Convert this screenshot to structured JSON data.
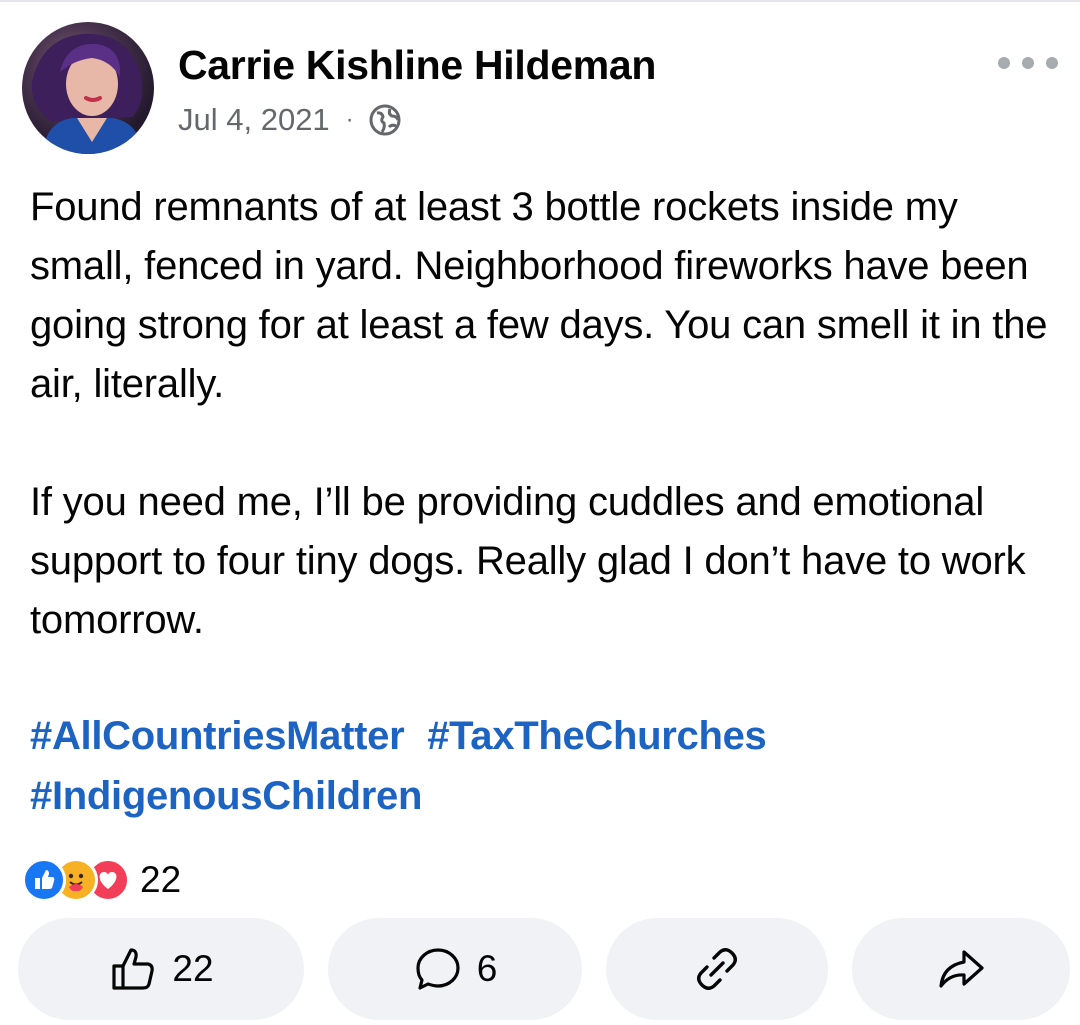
{
  "post": {
    "author": "Carrie Kishline Hildeman",
    "date": "Jul 4, 2021",
    "separator": "·",
    "privacy_icon": "globe-icon",
    "more_icon": "more-horizontal-icon",
    "body": "Found remnants of at least 3 bottle rockets inside my small, fenced in yard. Neighborhood fireworks have been going strong for at least a few days. You can smell it in the air, literally.\n\nIf you need me, I’ll be providing cuddles and emotional support to four tiny dogs. Really glad I don’t have to work tomorrow.",
    "hashtags": [
      "#AllCountriesMatter",
      "#TaxTheChurches",
      "#IndigenousChildren"
    ]
  },
  "reactions": {
    "icons": [
      "like-reaction-icon",
      "care-reaction-icon",
      "love-reaction-icon"
    ],
    "count": "22"
  },
  "actions": {
    "like_count": "22",
    "comment_count": "6",
    "like_icon": "thumbs-up-icon",
    "comment_icon": "comment-icon",
    "link_icon": "link-icon",
    "share_icon": "share-icon"
  },
  "colors": {
    "hashtag": "#1d63c2",
    "secondary_text": "#65676b",
    "button_bg": "#f0f2f5",
    "like_blue": "#1877f2",
    "love_red": "#f33e58",
    "care_yellow": "#f7b125"
  }
}
